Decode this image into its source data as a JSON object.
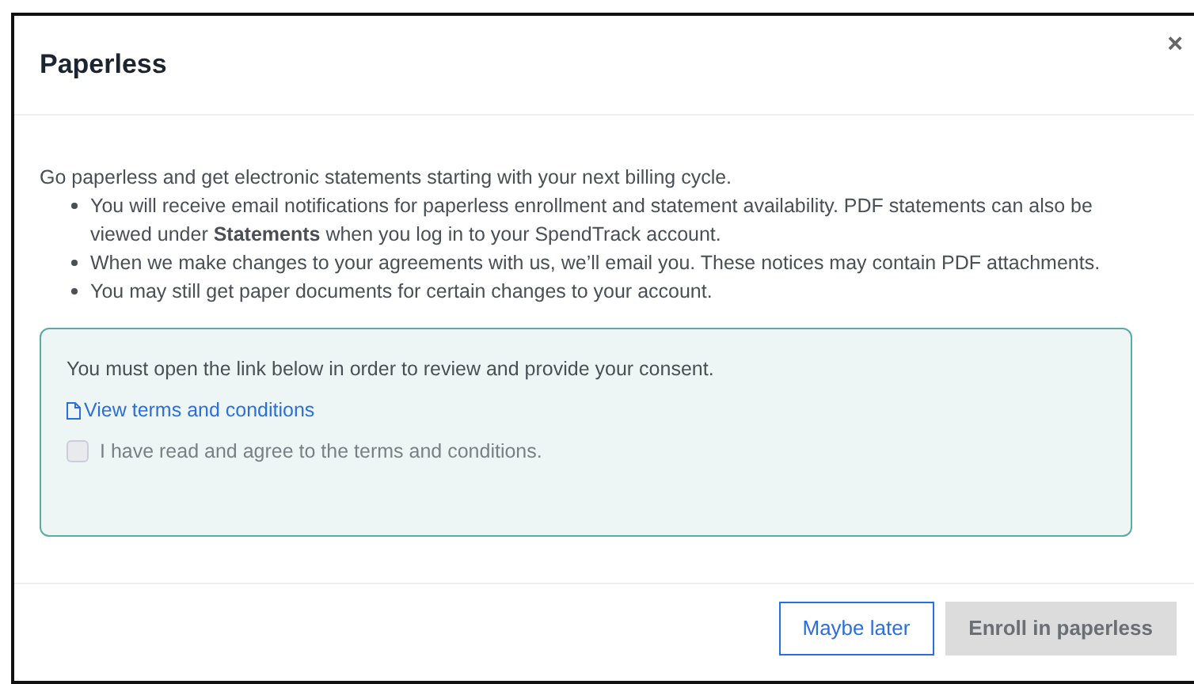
{
  "dialog": {
    "title": "Paperless",
    "close": "×"
  },
  "intro": "Go paperless and get electronic statements starting with your next billing cycle.",
  "bullets": [
    "You will receive email notifications for paperless enrollment and statement availability. PDF statements can also be viewed under **Statements** when you log in to your SpendTrack account.",
    "When we make changes to your agreements with us, we’ll email you. These notices may contain PDF attachments.",
    "You may still get paper documents for certain changes to your account."
  ],
  "consent": {
    "message": "You must open the link below in order to review and provide your consent.",
    "link": "View terms and conditions",
    "checkbox": {
      "label": "I have read and agree to the terms and conditions.",
      "checked": false,
      "disabled": true
    }
  },
  "buttons": [
    {
      "label": "Maybe later",
      "kind": "secondary",
      "disabled": false
    },
    {
      "label": "Enroll in paperless",
      "kind": "primary",
      "disabled": true
    }
  ]
}
